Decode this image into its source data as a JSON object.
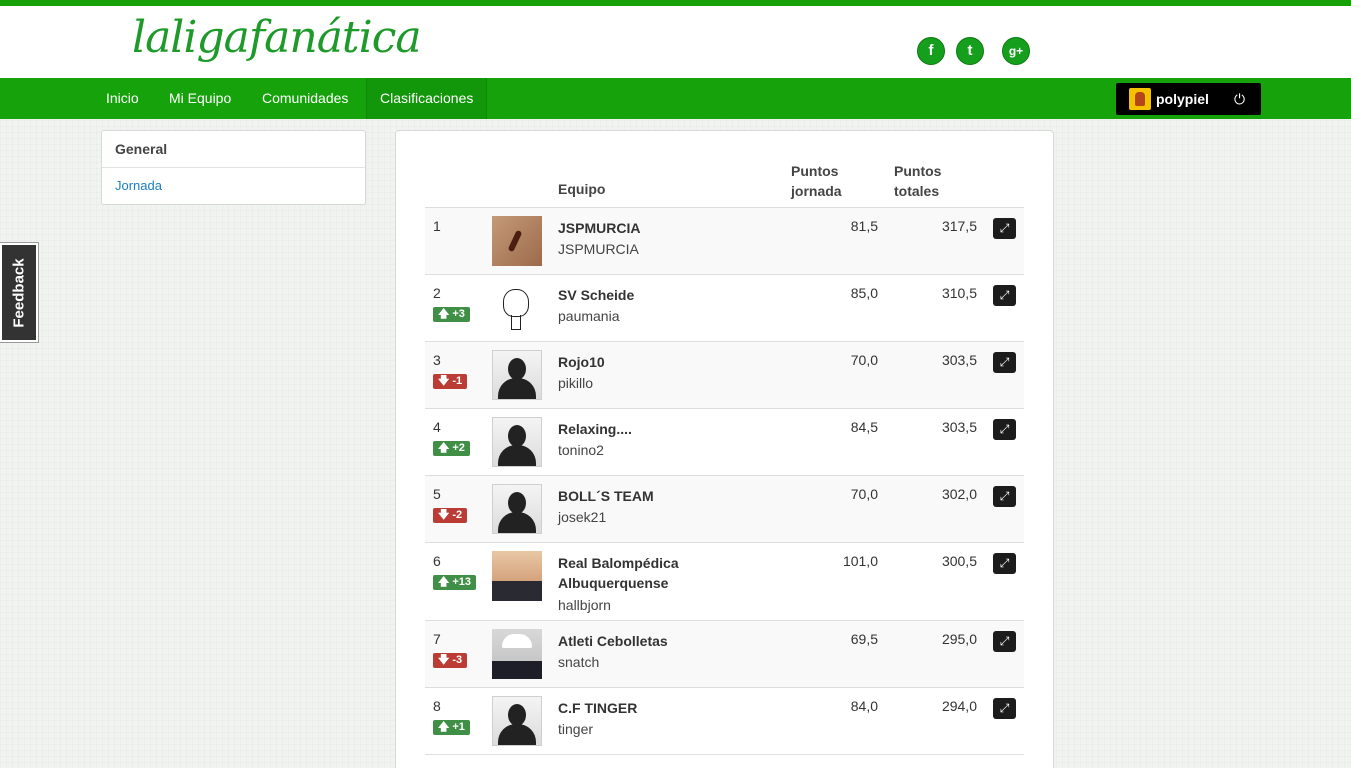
{
  "header": {
    "logo": "laligafanática",
    "social": [
      "f",
      "t",
      "g+"
    ]
  },
  "nav": {
    "items": [
      "Inicio",
      "Mi Equipo",
      "Comunidades",
      "Clasificaciones"
    ],
    "active": "Clasificaciones",
    "user": {
      "name": "polypiel",
      "logout_icon": "power-icon"
    }
  },
  "sidebar": {
    "general": "General",
    "jornada": "Jornada"
  },
  "feedback": "Feedback",
  "table": {
    "col_team": "Equipo",
    "col_puntos_jornada_1": "Puntos",
    "col_puntos_jornada_2": "jornada",
    "col_puntos_totales_1": "Puntos",
    "col_puntos_totales_2": "totales",
    "rows": [
      {
        "pos": "1",
        "change": "",
        "dir": "",
        "team": "JSPMURCIA",
        "owner": "JSPMURCIA",
        "pj": "81,5",
        "pt": "317,5",
        "avatar": "photo1"
      },
      {
        "pos": "2",
        "change": "+3",
        "dir": "up",
        "team": "SV Scheide",
        "owner": "paumania",
        "pj": "85,0",
        "pt": "310,5",
        "avatar": "face"
      },
      {
        "pos": "3",
        "change": "-1",
        "dir": "down",
        "team": "Rojo10",
        "owner": "pikillo",
        "pj": "70,0",
        "pt": "303,5",
        "avatar": "silhouette"
      },
      {
        "pos": "4",
        "change": "+2",
        "dir": "up",
        "team": "Relaxing....",
        "owner": "tonino2",
        "pj": "84,5",
        "pt": "303,5",
        "avatar": "silhouette"
      },
      {
        "pos": "5",
        "change": "-2",
        "dir": "down",
        "team": "BOLL´S TEAM",
        "owner": "josek21",
        "pj": "70,0",
        "pt": "302,0",
        "avatar": "silhouette"
      },
      {
        "pos": "6",
        "change": "+13",
        "dir": "up",
        "team": "Real Balompédica Albuquerquense",
        "owner": "hallbjorn",
        "pj": "101,0",
        "pt": "300,5",
        "avatar": "photo2"
      },
      {
        "pos": "7",
        "change": "-3",
        "dir": "down",
        "team": "Atleti Cebolletas",
        "owner": "snatch",
        "pj": "69,5",
        "pt": "295,0",
        "avatar": "photo3"
      },
      {
        "pos": "8",
        "change": "+1",
        "dir": "up",
        "team": "C.F TINGER",
        "owner": "tinger",
        "pj": "84,0",
        "pt": "294,0",
        "avatar": "silhouette"
      }
    ]
  }
}
